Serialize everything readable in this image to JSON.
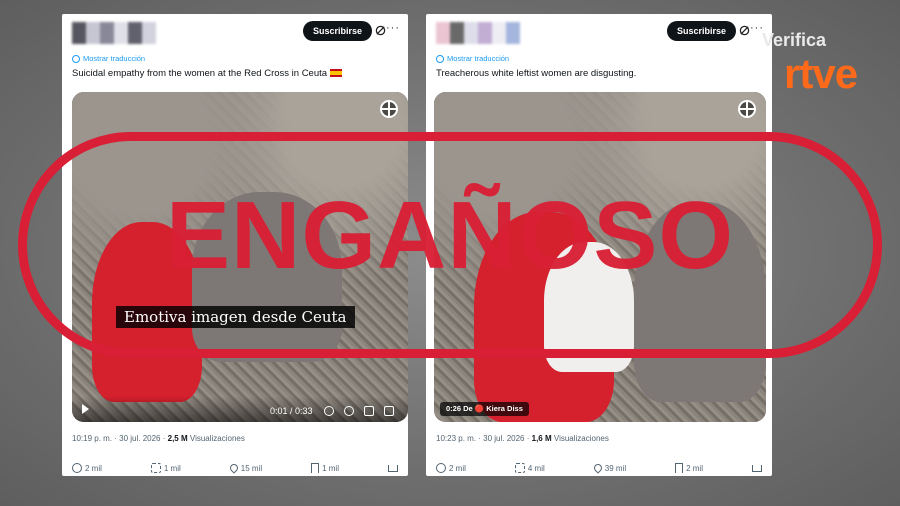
{
  "posts": [
    {
      "subscribe_label": "Suscribirse",
      "translate_label": "Mostrar traducción",
      "text": "Suicidal empathy from the women at the Red Cross in Ceuta",
      "flag": "spain-flag",
      "video_caption": "Emotiva imagen desde Ceuta",
      "video_time": "0:01 / 0:33",
      "timestamp": "10:19 p. m. · 30 jul. 2026 ·",
      "views_count": "2,5 M",
      "views_label": "Visualizaciones",
      "replies": "2 mil",
      "reposts": "1 mil",
      "likes": "15 mil",
      "bookmarks": "1 mil"
    },
    {
      "subscribe_label": "Suscribirse",
      "translate_label": "Mostrar traducción",
      "text": "Treacherous white leftist women are disgusting.",
      "video_badge": "0:26 De 🔴 Kiera Diss",
      "timestamp": "10:23 p. m. · 30 jul. 2026 ·",
      "views_count": "1,6 M",
      "views_label": "Visualizaciones",
      "replies": "2 mil",
      "reposts": "4 mil",
      "likes": "39 mil",
      "bookmarks": "2 mil"
    }
  ],
  "stamp": {
    "word": "ENGAÑOSO",
    "color": "#d91f35"
  },
  "brand": {
    "verifica": "Verifica",
    "rtve": "rtve",
    "rtve_color": "#ff6a1a"
  }
}
